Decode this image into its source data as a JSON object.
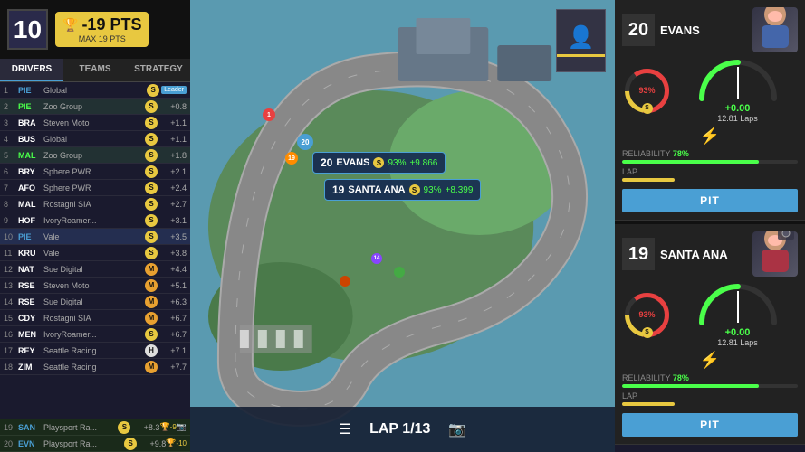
{
  "topBar": {
    "position": "10",
    "ptsLabel": "-19 PTS",
    "ptsSubLabel": "MAX 19 PTS",
    "trophyIcon": "🏆"
  },
  "navTabs": [
    {
      "id": "drivers",
      "label": "DRIVERS",
      "active": true
    },
    {
      "id": "teams",
      "label": "TEAMS",
      "active": false
    },
    {
      "id": "strategy",
      "label": "STRATEGY",
      "active": false
    }
  ],
  "drivers": [
    {
      "pos": "1",
      "code": "PIE",
      "team": "Global",
      "tire": "S",
      "gap": "Leader",
      "special": "leader"
    },
    {
      "pos": "2",
      "code": "PIE",
      "team": "Zoo Group",
      "tire": "S",
      "gap": "+0.8"
    },
    {
      "pos": "3",
      "code": "BRA",
      "team": "Steven Moto",
      "tire": "S",
      "gap": "+1.1"
    },
    {
      "pos": "4",
      "code": "BUS",
      "team": "Global",
      "tire": "S",
      "gap": "+1.1"
    },
    {
      "pos": "5",
      "code": "MAL",
      "team": "Zoo Group",
      "tire": "S",
      "gap": "+1.8"
    },
    {
      "pos": "6",
      "code": "BRY",
      "team": "Sphere PWR",
      "tire": "S",
      "gap": "+2.1"
    },
    {
      "pos": "7",
      "code": "AFO",
      "team": "Sphere PWR",
      "tire": "S",
      "gap": "+2.4"
    },
    {
      "pos": "8",
      "code": "MAL",
      "team": "Rostagni SIA",
      "tire": "S",
      "gap": "+2.7"
    },
    {
      "pos": "9",
      "code": "HOF",
      "team": "IvoryRoamer...",
      "tire": "S",
      "gap": "+3.1"
    },
    {
      "pos": "10",
      "code": "PIE",
      "team": "Vale",
      "tire": "S",
      "gap": "+3.5"
    },
    {
      "pos": "11",
      "code": "KRU",
      "team": "Vale",
      "tire": "S",
      "gap": "+3.8"
    },
    {
      "pos": "12",
      "code": "NAT",
      "team": "Sue Digital",
      "tire": "M",
      "gap": "+4.4"
    },
    {
      "pos": "13",
      "code": "RSE",
      "team": "Steven Moto",
      "tire": "M",
      "gap": "+5.1"
    },
    {
      "pos": "14",
      "code": "RSE",
      "team": "Sue Digital",
      "tire": "M",
      "gap": "+6.3"
    },
    {
      "pos": "15",
      "code": "CDY",
      "team": "Rostagni SIA",
      "tire": "M",
      "gap": "+6.7"
    },
    {
      "pos": "16",
      "code": "MEN",
      "team": "IvoryRoamer...",
      "tire": "S",
      "gap": "+6.7"
    },
    {
      "pos": "17",
      "code": "REY",
      "team": "Seattle Racing",
      "tire": "H",
      "gap": "+7.1"
    },
    {
      "pos": "18",
      "code": "ZIM",
      "team": "Seattle Racing",
      "tire": "M",
      "gap": "+7.7"
    }
  ],
  "bottomDrivers": [
    {
      "pos": "19",
      "code": "SAN",
      "team": "Playsport Ra...",
      "tire": "S",
      "gap": "+8.3",
      "trophy": "-9"
    },
    {
      "pos": "20",
      "code": "EVN",
      "team": "Playsport Ra...",
      "tire": "S",
      "gap": "+9.8",
      "trophy": "-10"
    }
  ],
  "trackCallouts": [
    {
      "id": "evans",
      "num": "20",
      "name": "EVANS",
      "tire": "S",
      "pct": "93%",
      "gap": "+9.866",
      "top": "168",
      "left": "360"
    },
    {
      "id": "santaana",
      "num": "19",
      "name": "SANTA ANA",
      "tire": "S",
      "pct": "93%",
      "gap": "+8.399",
      "top": "198",
      "left": "370"
    }
  ],
  "rightPanel": {
    "driver1": {
      "num": "20",
      "name": "EVANS",
      "reliability": "78%",
      "relBarWidth": "78",
      "reliabilityLabel": "RELIABILITY",
      "lapLabel": "LAP",
      "pitLabel": "PIT",
      "tireType": "S",
      "speedVal": "+0.00",
      "lapsVal": "12.81 Laps",
      "pct": "93%"
    },
    "driver2": {
      "num": "19",
      "name": "SANTA ANA",
      "reliability": "78%",
      "relBarWidth": "78",
      "reliabilityLabel": "RELIABILITY",
      "lapLabel": "LAP",
      "pitLabel": "PIT",
      "tireType": "S",
      "speedVal": "+0.00",
      "lapsVal": "12.81 Laps",
      "pct": "93%"
    }
  },
  "bottomBar": {
    "lapText": "LAP 1/13",
    "menuIcon": "☰",
    "camIcon": "📷"
  },
  "pitLabel": "PIt"
}
